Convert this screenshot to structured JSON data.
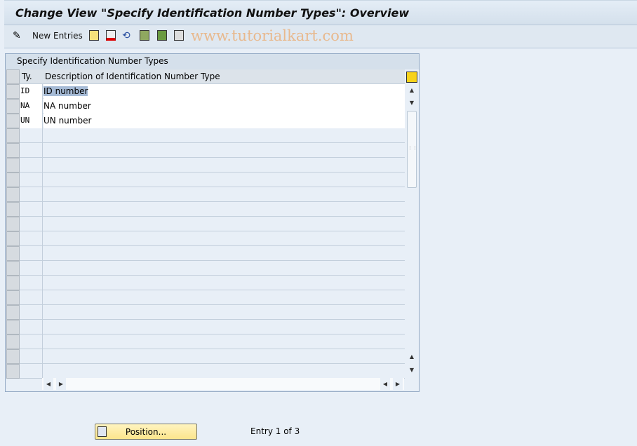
{
  "window": {
    "title": "Change View \"Specify Identification Number Types\": Overview"
  },
  "toolbar": {
    "new_entries_label": "New Entries",
    "icons": [
      "edit-glasses-icon",
      "copy-icon",
      "delete-icon",
      "undo-icon",
      "select-all-icon",
      "select-block-icon",
      "deselect-all-icon"
    ],
    "watermark": "www.tutorialkart.com"
  },
  "table": {
    "title": "Specify Identification Number Types",
    "columns": [
      "Ty.",
      "Description of Identification Number Type"
    ],
    "rows": [
      [
        "ID",
        "ID number"
      ],
      [
        "NA",
        "NA number"
      ],
      [
        "UN",
        "UN number"
      ]
    ],
    "empty_rows": 17
  },
  "footer": {
    "position_label": "Position...",
    "entry_status": "Entry 1 of 3"
  }
}
